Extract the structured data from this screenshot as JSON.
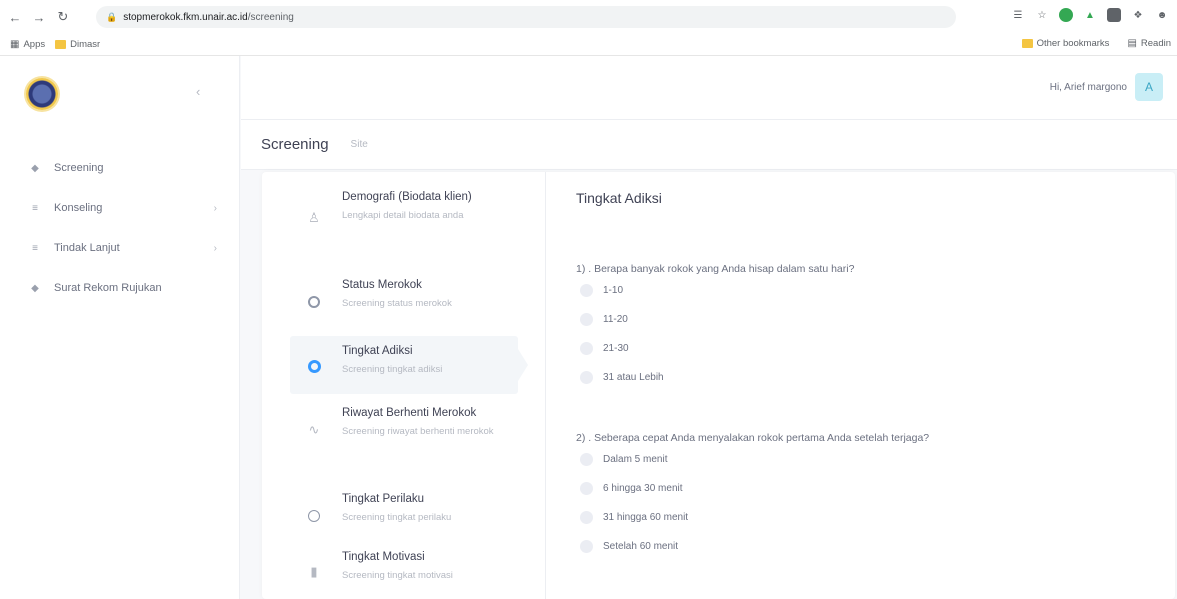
{
  "browser": {
    "url_host": "stopmerokok.fkm.unair.ac.id",
    "url_path": "/screening",
    "bookmarks": [
      {
        "label": "Apps"
      },
      {
        "label": "Dimasr"
      }
    ],
    "other_bookmarks": "Other bookmarks",
    "reading_list": "Readin"
  },
  "sidebar": {
    "items": [
      {
        "label": "Screening",
        "icon": "dot-icon",
        "has_children": false
      },
      {
        "label": "Konseling",
        "icon": "list-icon",
        "has_children": true
      },
      {
        "label": "Tindak Lanjut",
        "icon": "list-icon",
        "has_children": true
      },
      {
        "label": "Surat Rekom Rujukan",
        "icon": "dot-icon",
        "has_children": false
      }
    ]
  },
  "header": {
    "greeting": "Hi, Arief margono",
    "avatar_initial": "A"
  },
  "breadcrumb": {
    "title": "Screening",
    "sub": "Site"
  },
  "steps": [
    {
      "title": "Demografi (Biodata klien)",
      "desc": "Lengkapi detail biodata anda",
      "icon": "person-icon",
      "active": false
    },
    {
      "title": "Status Merokok",
      "desc": "Screening status merokok",
      "icon": "ring-icon",
      "active": false
    },
    {
      "title": "Tingkat Adiksi",
      "desc": "Screening tingkat adiksi",
      "icon": "ring-icon",
      "active": true
    },
    {
      "title": "Riwayat Berhenti Merokok",
      "desc": "Screening riwayat berhenti merokok",
      "icon": "pulse-icon",
      "active": false
    },
    {
      "title": "Tingkat Perilaku",
      "desc": "Screening tingkat perilaku",
      "icon": "circle-icon",
      "active": false
    },
    {
      "title": "Tingkat Motivasi",
      "desc": "Screening tingkat motivasi",
      "icon": "bar-chart-icon",
      "active": false
    }
  ],
  "form": {
    "title": "Tingkat Adiksi",
    "questions": [
      {
        "text": "1) . Berapa banyak rokok yang Anda hisap dalam satu hari?",
        "options": [
          "1-10",
          "11-20",
          "21-30",
          "31 atau Lebih"
        ]
      },
      {
        "text": "2) . Seberapa cepat Anda menyalakan rokok pertama Anda setelah terjaga?",
        "options": [
          "Dalam 5 menit",
          "6 hingga 30 menit",
          "31 hingga 60 menit",
          "Setelah 60 menit"
        ]
      }
    ]
  },
  "colors": {
    "accent": "#3699ff",
    "avatar_bg": "#c9eef6",
    "active_step_bg": "#f3f6f9"
  }
}
